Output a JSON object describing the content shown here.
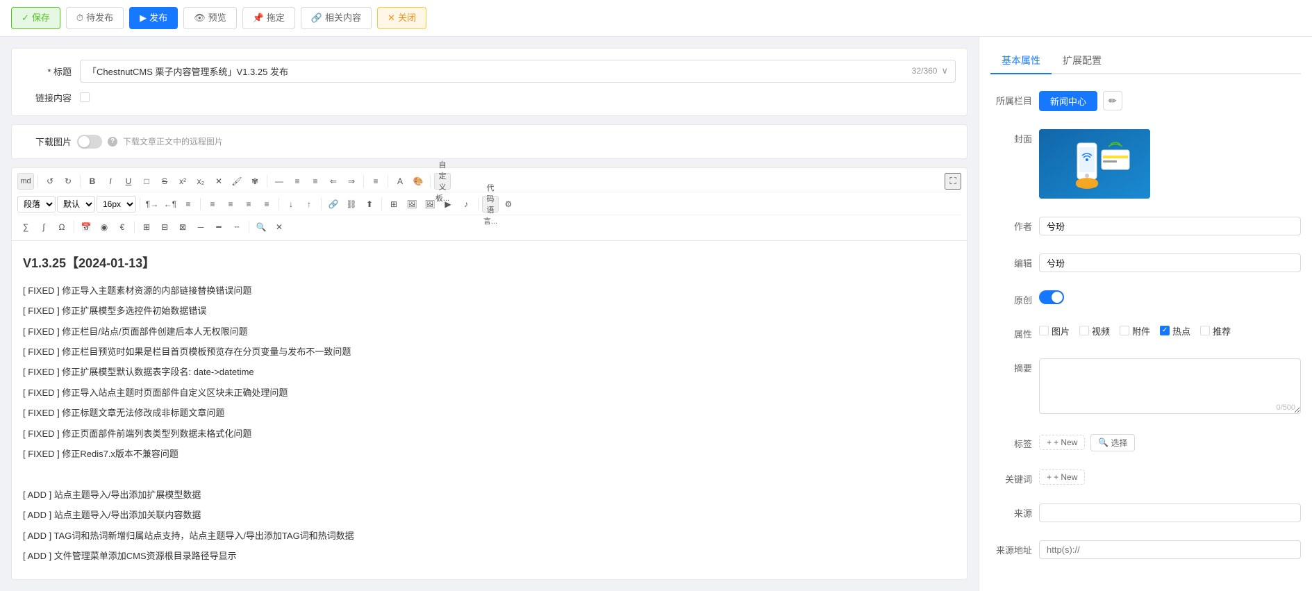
{
  "toolbar": {
    "save_label": "保存",
    "pending_label": "待发布",
    "publish_label": "发布",
    "preview_label": "预览",
    "pin_label": "拖定",
    "related_label": "相关内容",
    "close_label": "关闭"
  },
  "form": {
    "title_label": "* 标题",
    "title_value": "「ChestnutCMS 栗子内容管理系统」V1.3.25 发布",
    "title_count": "32/360",
    "link_label": "链接内容",
    "download_img_label": "下载图片",
    "download_img_hint": "下载文章正文中的远程图片"
  },
  "editor": {
    "toolbar": {
      "row1": [
        "md",
        "undo",
        "redo",
        "bold",
        "italic",
        "underline",
        "box",
        "strikethrough",
        "superscript",
        "subscript",
        "clear",
        "format_paint",
        "special",
        "hr",
        "list_ol",
        "list_ul",
        "outdent",
        "indent",
        "justify",
        "font_color",
        "bg_color",
        "custom_btn",
        "expand"
      ],
      "row2": [
        "para",
        "default",
        "16px",
        "text_dir_ltr",
        "text_dir_rtl",
        "indent2",
        "align_left",
        "align_center",
        "align_right",
        "justify2",
        "subscript2",
        "superscript2",
        "link",
        "unlink",
        "upload",
        "separator",
        "table_insert",
        "image",
        "image2",
        "video",
        "audio",
        "code_lang",
        "settings"
      ],
      "row3": [
        "math",
        "formula",
        "symbol",
        "date",
        "euro",
        "currency",
        "table",
        "table2",
        "table3",
        "hr2",
        "hr3",
        "hr4",
        "zoom_in",
        "close_editor"
      ]
    },
    "content": {
      "heading": "V1.3.25【2024-01-13】",
      "lines": [
        "[ FIXED ] 修正导入主题素材资源的内部链接替换错误问题",
        "[ FIXED ] 修正扩展模型多选控件初始数据错误",
        "[ FIXED ] 修正栏目/站点/页面部件创建后本人无权限问题",
        "[ FIXED ] 修正栏目预览时如果是栏目首页模板预览存在分页变量与发布不一致问题",
        "[ FIXED ] 修正扩展模型默认数据表字段名: date->datetime",
        "[ FIXED ] 修正导入站点主题时页面部件自定义区块未正确处理问题",
        "[ FIXED ] 修正标题文章无法修改成非标题文章问题",
        "[ FIXED ] 修正页面部件前端列表类型列数据未格式化问题",
        "[ FIXED ] 修正Redis7.x版本不兼容问题",
        "",
        "[ ADD ] 站点主题导入/导出添加扩展模型数据",
        "[ ADD ] 站点主题导入/导出添加关联内容数据",
        "[ ADD ] TAG词和热词新增归属站点支持，站点主题导入/导出添加TAG词和热词数据",
        "[ ADD ] 文件管理菜单添加CMS资源根目录路径导显示"
      ]
    }
  },
  "sidebar": {
    "tabs": [
      "基本属性",
      "扩展配置"
    ],
    "active_tab": "基本属性",
    "category_label": "所属栏目",
    "category_value": "新闻中心",
    "cover_label": "封面",
    "author_label": "作者",
    "author_value": "兮玢",
    "editor_label": "编辑",
    "editor_value": "兮玢",
    "original_label": "原创",
    "original_enabled": true,
    "attr_label": "属性",
    "attributes": [
      {
        "label": "图片",
        "checked": false
      },
      {
        "label": "视频",
        "checked": false
      },
      {
        "label": "附件",
        "checked": false
      },
      {
        "label": "热点",
        "checked": true
      },
      {
        "label": "推荐",
        "checked": false
      }
    ],
    "summary_label": "摘要",
    "summary_value": "",
    "summary_count": "0/500",
    "tag_label": "标签",
    "tag_add": "+ New",
    "tag_select": "🔍 选择",
    "keyword_label": "关键词",
    "keyword_add": "+ New",
    "source_label": "来源",
    "source_value": "",
    "source_url_label": "来源地址",
    "source_url_placeholder": "http(s)://"
  },
  "icons": {
    "save": "✓",
    "pending": "⏱",
    "publish": "▶",
    "preview": "👁",
    "pin": "📌",
    "related": "🔗",
    "close": "✕",
    "edit": "✏",
    "help": "?",
    "expand": "⛶",
    "plus": "+",
    "search": "🔍"
  }
}
